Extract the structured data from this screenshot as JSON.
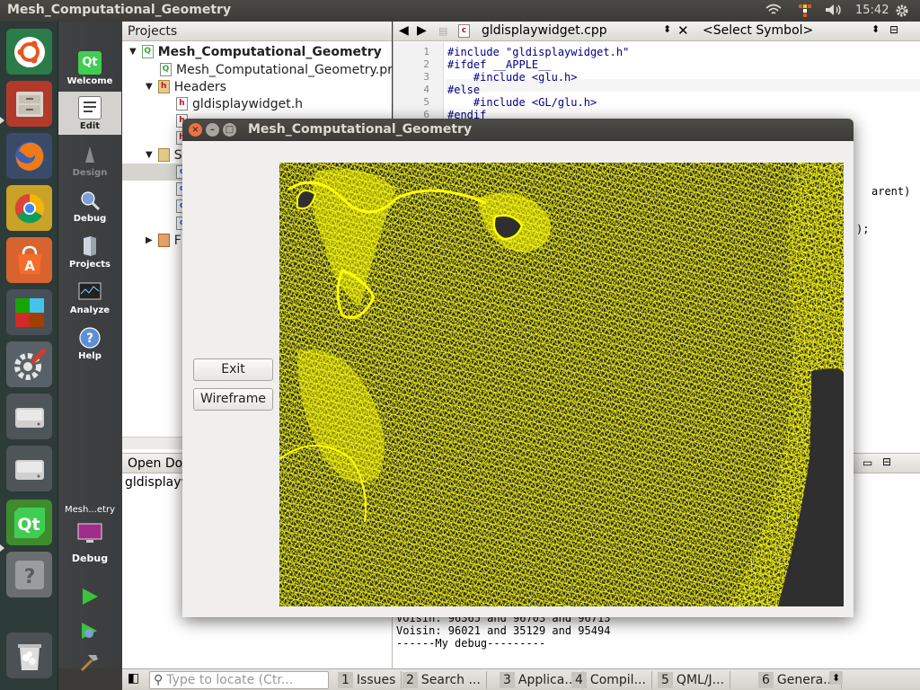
{
  "topbar": {
    "title": "Mesh_Computational_Geometry",
    "clock": "15:42"
  },
  "launcher": {
    "icons": [
      "ubuntu-dash-icon",
      "files-icon",
      "firefox-icon",
      "chrome-icon",
      "software-center-icon",
      "libreoffice-icon",
      "system-settings-icon",
      "disk-icon",
      "disk-icon",
      "qt-creator-icon",
      "help-icon",
      "trash-icon"
    ]
  },
  "modes": {
    "welcome": "Welcome",
    "edit": "Edit",
    "design": "Design",
    "debug": "Debug",
    "projects": "Projects",
    "analyze": "Analyze",
    "help": "Help",
    "kit_name": "Mesh...etry",
    "kit_mode": "Debug"
  },
  "projects": {
    "header": "Projects",
    "root": "Mesh_Computational_Geometry",
    "pro_file": "Mesh_Computational_Geometry.pro",
    "headers": "Headers",
    "header_file": "gldisplaywidget.h",
    "open_docs": "Open Do",
    "open_doc_file": "gldisplayw",
    "sources_initial": "S",
    "forms_initial": "F"
  },
  "editor": {
    "file": "gldisplaywidget.cpp",
    "symbol": "<Select Symbol>",
    "lines": [
      {
        "n": "1",
        "text": "#include \"gldisplaywidget.h\""
      },
      {
        "n": "2",
        "text": "#ifdef __APPLE__"
      },
      {
        "n": "3",
        "text": "    #include <glu.h>"
      },
      {
        "n": "4",
        "text": "#else"
      },
      {
        "n": "5",
        "text": "    #include <GL/glu.h>"
      },
      {
        "n": "6",
        "text": "#endif"
      }
    ],
    "frag_parent": "arent)",
    "frag_semicolon": ");"
  },
  "output": {
    "lines": [
      "Voisin: 96365 and 96703 and 96713",
      "Voisin: 96021 and 35129 and 95494",
      "------My debug---------"
    ]
  },
  "bottombar": {
    "locate_placeholder": "Type to locate (Ctr...",
    "tabs": [
      {
        "n": "1",
        "label": "Issues"
      },
      {
        "n": "2",
        "label": "Search ..."
      },
      {
        "n": "3",
        "label": "Applica..."
      },
      {
        "n": "4",
        "label": "Compil..."
      },
      {
        "n": "5",
        "label": "QML/J..."
      },
      {
        "n": "6",
        "label": "Genera..."
      }
    ]
  },
  "app": {
    "title": "Mesh_Computational_Geometry",
    "exit_label": "Exit",
    "wireframe_label": "Wireframe",
    "mesh_color": "#ffff00",
    "bg_color": "#2f2f2f"
  }
}
